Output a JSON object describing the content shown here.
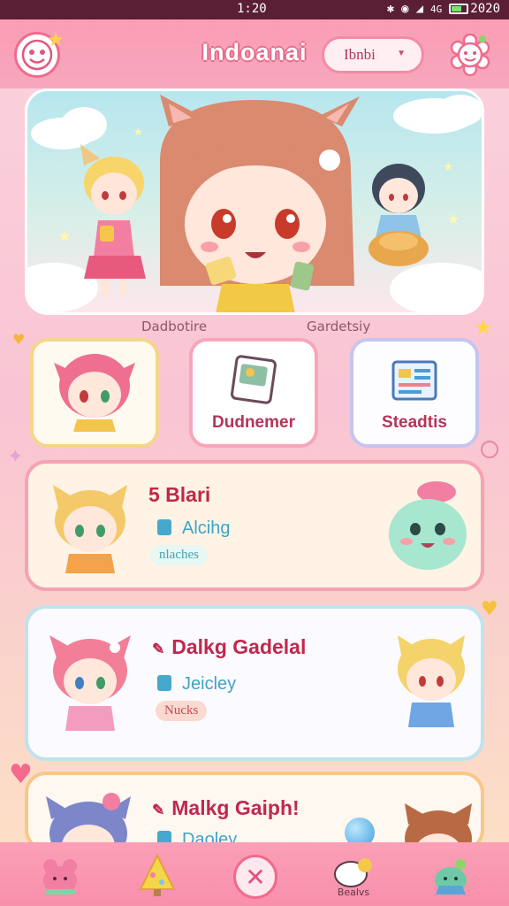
{
  "status_bar": {
    "time": "1:20",
    "network": "4G",
    "battery_text": "2020"
  },
  "header": {
    "title": "Indoanai",
    "dropdown_value": "Ibnbi"
  },
  "labels": {
    "left": "Dadbotire",
    "right": "Gardetsiy"
  },
  "cards": [
    {
      "label": ""
    },
    {
      "label": "Dudnemer"
    },
    {
      "label": "Steadtis"
    }
  ],
  "list": [
    {
      "title": "5 Blari",
      "subtitle": "Alcihg",
      "tag": "nlaches"
    },
    {
      "title": "Dalkg Gadelal",
      "subtitle": "Jeicley",
      "tag": "Nucks"
    },
    {
      "title": "Malkg Gaiph!",
      "subtitle": "Daoley"
    }
  ],
  "bottom_nav": {
    "caption": "Bealvs"
  },
  "colors": {
    "accent": "#f06b8d",
    "header": "#fa9db4",
    "title_red": "#c0284e",
    "sub_blue": "#3fa3c8"
  }
}
